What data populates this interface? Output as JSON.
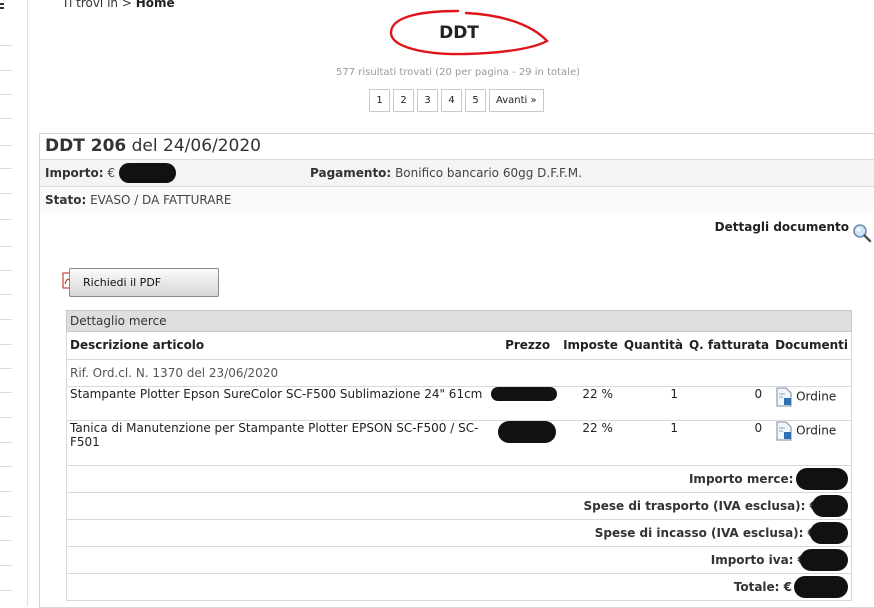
{
  "breadcrumb": {
    "prefix": "Ti trovi in >",
    "current": "Home"
  },
  "page_title": "DDT",
  "results_info": "577 risultati trovati (20 per pagina - 29 in totale)",
  "pager": {
    "pages": [
      "1",
      "2",
      "3",
      "4",
      "5"
    ],
    "next_label": "Avanti »"
  },
  "document": {
    "title_number": "DDT 206",
    "title_date": "del 24/06/2020",
    "importo_label": "Importo:",
    "importo_currency": "€",
    "pagamento_label": "Pagamento:",
    "pagamento_value": "Bonifico bancario 60gg D.F.F.M.",
    "stato_label": "Stato:",
    "stato_value": "EVASO / DA FATTURARE",
    "details_link": "Dettagli documento",
    "pdf_button": "Richiedi il PDF"
  },
  "merce": {
    "title": "Dettaglio merce",
    "columns": [
      "Descrizione articolo",
      "Prezzo",
      "Imposte",
      "Quantità",
      "Q. fatturata",
      "Documenti"
    ],
    "reference": "Rif. Ord.cl. N. 1370 del 23/06/2020",
    "items": [
      {
        "description": "Stampante Plotter Epson SureColor SC-F500 Sublimazione 24\" 61cm",
        "imposte": "22 %",
        "quantita": "1",
        "fatturata": "0",
        "documento": "Ordine"
      },
      {
        "description": "Tanica di Manutenzione per Stampante Plotter EPSON SC-F500 / SC-F501",
        "imposte": "22 %",
        "quantita": "1",
        "fatturata": "0",
        "documento": "Ordine"
      }
    ],
    "totals": [
      {
        "label": "Importo merce: €"
      },
      {
        "label": "Spese di trasporto (IVA esclusa): €"
      },
      {
        "label": "Spese di incasso (IVA esclusa): €"
      },
      {
        "label": "Importo iva: €"
      },
      {
        "label": "Totale: €"
      }
    ]
  },
  "colors": {
    "annotation_red": "#e0151b",
    "redaction": "#111111",
    "section_header_bg": "#dedede"
  },
  "icons": {
    "search": "magnifier-icon",
    "pdf": "pdf-file-icon",
    "document": "document-icon"
  }
}
